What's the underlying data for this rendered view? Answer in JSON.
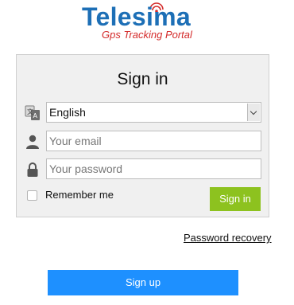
{
  "brand": {
    "name": "Telesima",
    "tagline": "Gps Tracking Portal",
    "colors": {
      "wordmark": "#1d6fb6",
      "tagline": "#d42b2b"
    }
  },
  "signin": {
    "title": "Sign in",
    "language": {
      "selected": "English",
      "icon": "language-translate-icon"
    },
    "email": {
      "placeholder": "Your email",
      "value": "",
      "icon": "user-icon"
    },
    "password": {
      "placeholder": "Your password",
      "value": "",
      "icon": "lock-icon"
    },
    "remember_label": "Remember me",
    "remember_checked": false,
    "submit_label": "Sign in",
    "submit_color": "#8dc21f"
  },
  "links": {
    "password_recovery": "Password recovery"
  },
  "signup": {
    "label": "Sign up",
    "color": "#1e90ff"
  }
}
